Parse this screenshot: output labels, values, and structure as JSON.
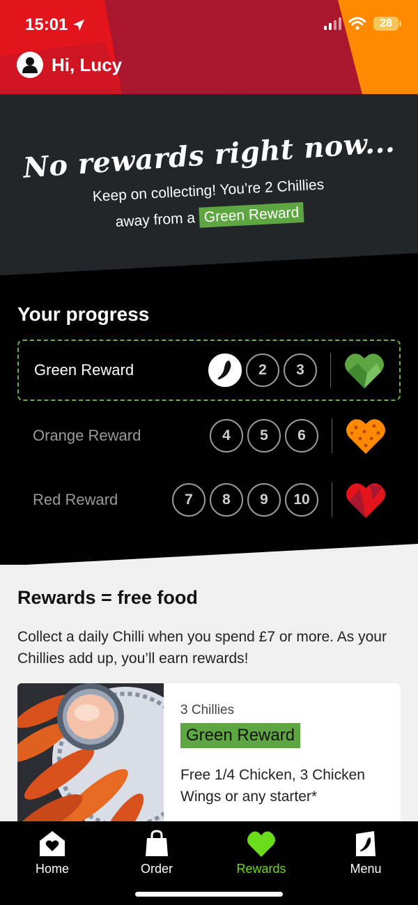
{
  "status": {
    "time": "15:01",
    "battery": "28"
  },
  "header": {
    "greeting": "Hi, Lucy"
  },
  "banner": {
    "title": "No rewards right now...",
    "line1": "Keep on collecting! You’re 2 Chillies",
    "line2_prefix": "away from a",
    "line2_tag": "Green Reward"
  },
  "progress": {
    "title": "Your progress",
    "rows": [
      {
        "label": "Green Reward",
        "steps": [
          "1",
          "2",
          "3"
        ],
        "heart": "green-heart-icon"
      },
      {
        "label": "Orange Reward",
        "steps": [
          "4",
          "5",
          "6"
        ],
        "heart": "orange-heart-icon"
      },
      {
        "label": "Red Reward",
        "steps": [
          "7",
          "8",
          "9",
          "10"
        ],
        "heart": "red-heart-icon"
      }
    ],
    "chillies_collected": 1
  },
  "info": {
    "title": "Rewards = free food",
    "body": "Collect a daily Chilli when you spend £7 or more. As your Chillies add up, you’ll earn rewards!",
    "card": {
      "count": "3 Chillies",
      "tag": "Green Reward",
      "desc": "Free 1/4 Chicken, 3 Chicken Wings or any starter*"
    }
  },
  "tabs": [
    {
      "label": "Home",
      "icon": "home-icon"
    },
    {
      "label": "Order",
      "icon": "bag-icon"
    },
    {
      "label": "Rewards",
      "icon": "heart-icon",
      "active": true
    },
    {
      "label": "Menu",
      "icon": "menu-icon"
    }
  ],
  "colors": {
    "brand_red": "#e4141d",
    "green": "#5ea642",
    "orange": "#ff8a00",
    "active_tab": "#6bdc1c"
  }
}
